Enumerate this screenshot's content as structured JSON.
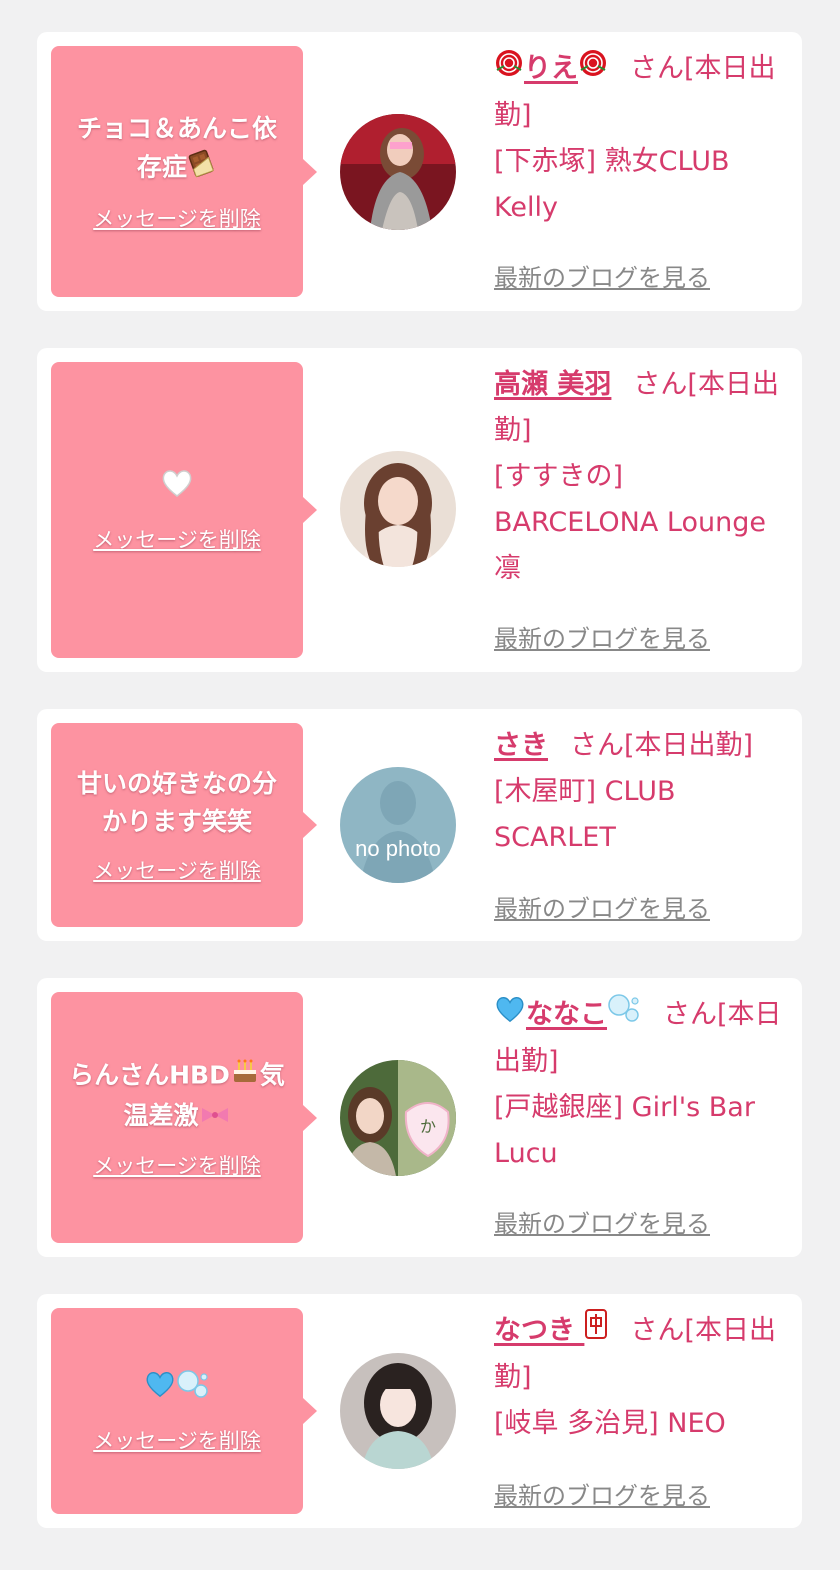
{
  "delete_label": "メッセージを削除",
  "blog_label": "最新のブログを見る",
  "colors": {
    "bubble": "#fd93a1",
    "accent": "#d63b6c",
    "link_gray": "#888888",
    "background": "#f1f1f2"
  },
  "cards": [
    {
      "message": "チョコ＆あんこ依存症",
      "message_emoji": "chocolate-bar",
      "name": "りえ",
      "name_prefix_icon": "rose-icon",
      "name_suffix_icon": "rose-icon",
      "suffix": "さん[本日出勤]",
      "area": "[下赤塚]",
      "shop": "熟女CLUB Kelly",
      "avatar": "photo-woman-red"
    },
    {
      "message": "",
      "message_emoji": "white-heart",
      "name": "高瀬 美羽",
      "suffix": "さん[本日出勤]",
      "area": "[すすきの]",
      "shop": "BARCELONA Lounge 凛",
      "avatar": "photo-woman-brown"
    },
    {
      "message": "甘いの好きなの分かります笑笑",
      "name": "さき",
      "suffix": "さん[本日出勤]",
      "area": "[木屋町]",
      "shop": "CLUB SCARLET",
      "avatar": "no-photo",
      "avatar_text": "no photo"
    },
    {
      "message": "らんさんHBD",
      "message_mid_emoji": "birthday-cake",
      "message_tail": "気温差激",
      "message_tail_emoji": "pink-ribbon",
      "name": "ななこ",
      "name_prefix_icon": "blue-heart-icon",
      "name_suffix_icon": "bubbles-icon",
      "suffix": "さん[本日出勤]",
      "area": "[戸越銀座]",
      "shop": "Girl's Bar Lucu",
      "avatar": "photo-two-women",
      "avatar_text": "か"
    },
    {
      "message": "",
      "message_emoji": "blue-heart-bubbles",
      "name": "なつき",
      "name_suffix_icon": "mahjong-red-dragon-icon",
      "suffix": "さん[本日出勤]",
      "area": "[岐阜 多治見]",
      "shop": "NEO",
      "avatar": "photo-woman-dark-hair"
    }
  ]
}
